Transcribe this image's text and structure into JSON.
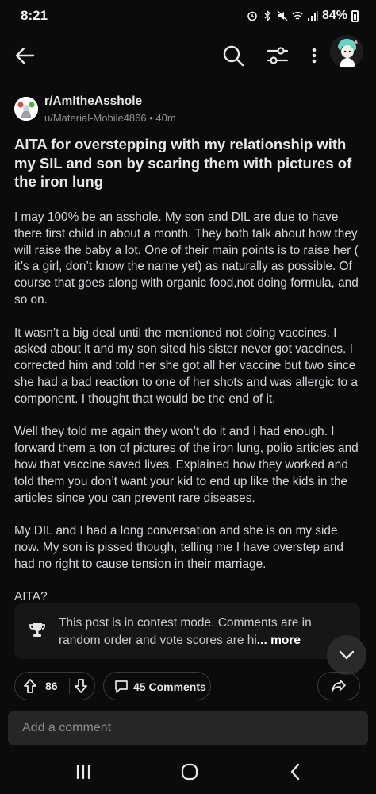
{
  "status_bar": {
    "time": "8:21",
    "battery": "84%"
  },
  "app_bar": {
    "icons": [
      "back-arrow-icon",
      "search-icon",
      "filter-icon",
      "more-vert-icon",
      "avatar"
    ]
  },
  "post": {
    "subreddit": "r/AmItheAsshole",
    "author": "u/Material-Mobile4866",
    "age": "40m",
    "title": "AITA for overstepping with my relationship with my SIL and son by scaring them with pictures of the iron lung",
    "paragraphs": [
      "I may 100% be an asshole. My son and DIL are due to have there first child in about a month. They both talk about how they will raise the baby a lot. One of their main points is to raise her ( it’s a girl, don’t know the name yet) as naturally as possible. Of course that goes along with organic food,not doing formula, and so on.",
      "It wasn’t a big deal until the mentioned not doing vaccines. I asked about it and my son sited his sister never got vaccines. I corrected him and told her she got all her vaccine but two since she had a bad reaction to one of her shots and was allergic to a component. I thought that would be the end of it.",
      "Well they told me again they won’t do it and I had enough. I forward them a ton of pictures of the iron lung, polio articles and how that vaccine saved lives. Explained how they worked and told them you don’t want your kid to end up like the kids in the articles since you can prevent rare diseases.",
      "My DIL and I had a long conversation and she is on my side now. My son is pissed though, telling me I have overstep and had no right to cause tension in their marriage.",
      "AITA?"
    ]
  },
  "notice": {
    "text": "This post is in contest mode. Comments are in random order and vote scores are hi",
    "more_label": "... more"
  },
  "actions": {
    "votes": "86",
    "comments_label": "45 Comments"
  },
  "comment_box": {
    "placeholder": "Add a comment"
  },
  "colors": {
    "background": "#0b0b0b",
    "text": "#d7dadc",
    "notice_bg": "#161616",
    "input_bg": "#262626"
  }
}
